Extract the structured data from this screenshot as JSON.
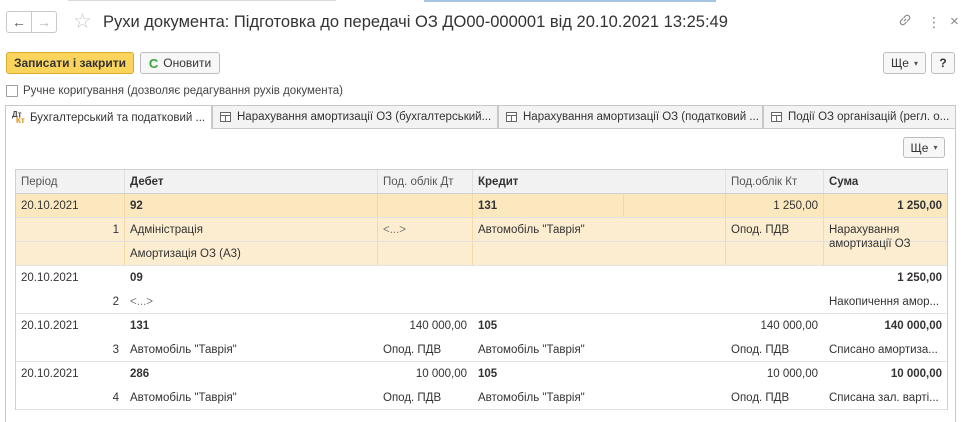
{
  "header": {
    "title": "Рухи документа: Підготовка до передачі ОЗ ДО00-000001 від 20.10.2021 13:25:49",
    "back_glyph": "←",
    "forward_glyph": "→",
    "star_glyph": "☆",
    "link_glyph": "🔗",
    "menu_glyph": "⋮",
    "close_glyph": "×"
  },
  "toolbar": {
    "save_close_label": "Записати і закрити",
    "refresh_label": "Оновити",
    "refresh_glyph": "C",
    "more_label": "Ще",
    "more_caret": "▾",
    "help_label": "?"
  },
  "manual_edit": {
    "label": "Ручне коригування (дозволяє редагування рухів документа)"
  },
  "tabs": [
    {
      "label": "Бухгалтерський та податковий ..."
    },
    {
      "label": "Нарахування амортизації ОЗ (бухгалтерський..."
    },
    {
      "label": "Нарахування амортизації ОЗ (податковий ..."
    },
    {
      "label": "Події ОЗ організацій (регл. о..."
    }
  ],
  "panel": {
    "more_label": "Ще",
    "more_caret": "▾"
  },
  "table": {
    "columns": {
      "period": "Період",
      "debet": "Дебет",
      "pod_dt": "Под. облік Дт",
      "kredit": "Кредит",
      "pod_kt": "Под.облік Кт",
      "suma": "Сума"
    },
    "entries": [
      {
        "period": "20.10.2021",
        "debet_account": "92",
        "pod_dt_amount": "",
        "kredit_account": "131",
        "pod_kt_amount": "1 250,00",
        "amount": "1 250,00",
        "line_no": "1",
        "debet_sub1": "Адміністрація",
        "debet_sub2": "Амортизація ОЗ (А3)",
        "pod_dt_sub": "<...>",
        "kredit_sub1": "Автомобіль \"Таврія\"",
        "pod_kt_sub": "Опод. ПДВ",
        "content": "Нарахування амортизації ОЗ"
      },
      {
        "period": "20.10.2021",
        "debet_account": "09",
        "pod_dt_amount": "",
        "kredit_account": "",
        "pod_kt_amount": "",
        "amount": "1 250,00",
        "line_no": "2",
        "debet_sub1": "<...>",
        "pod_dt_sub": "",
        "kredit_sub1": "",
        "pod_kt_sub": "",
        "content": "Накопичення амор..."
      },
      {
        "period": "20.10.2021",
        "debet_account": "131",
        "pod_dt_amount": "140 000,00",
        "kredit_account": "105",
        "pod_kt_amount": "140 000,00",
        "amount": "140 000,00",
        "line_no": "3",
        "debet_sub1": "Автомобіль \"Таврія\"",
        "pod_dt_sub": "Опод. ПДВ",
        "kredit_sub1": "Автомобіль \"Таврія\"",
        "pod_kt_sub": "Опод. ПДВ",
        "content": "Списано амортиза..."
      },
      {
        "period": "20.10.2021",
        "debet_account": "286",
        "pod_dt_amount": "10 000,00",
        "kredit_account": "105",
        "pod_kt_amount": "10 000,00",
        "amount": "10 000,00",
        "line_no": "4",
        "debet_sub1": "Автомобіль \"Таврія\"",
        "pod_dt_sub": "Опод. ПДВ",
        "kredit_sub1": "Автомобіль \"Таврія\"",
        "pod_kt_sub": "Опод. ПДВ",
        "content": "Списана зал. варті..."
      }
    ]
  },
  "colors": {
    "primary_button": "#fbd45d",
    "selected_row": "#fbe8bf",
    "refresh_icon": "#3aa33a"
  }
}
